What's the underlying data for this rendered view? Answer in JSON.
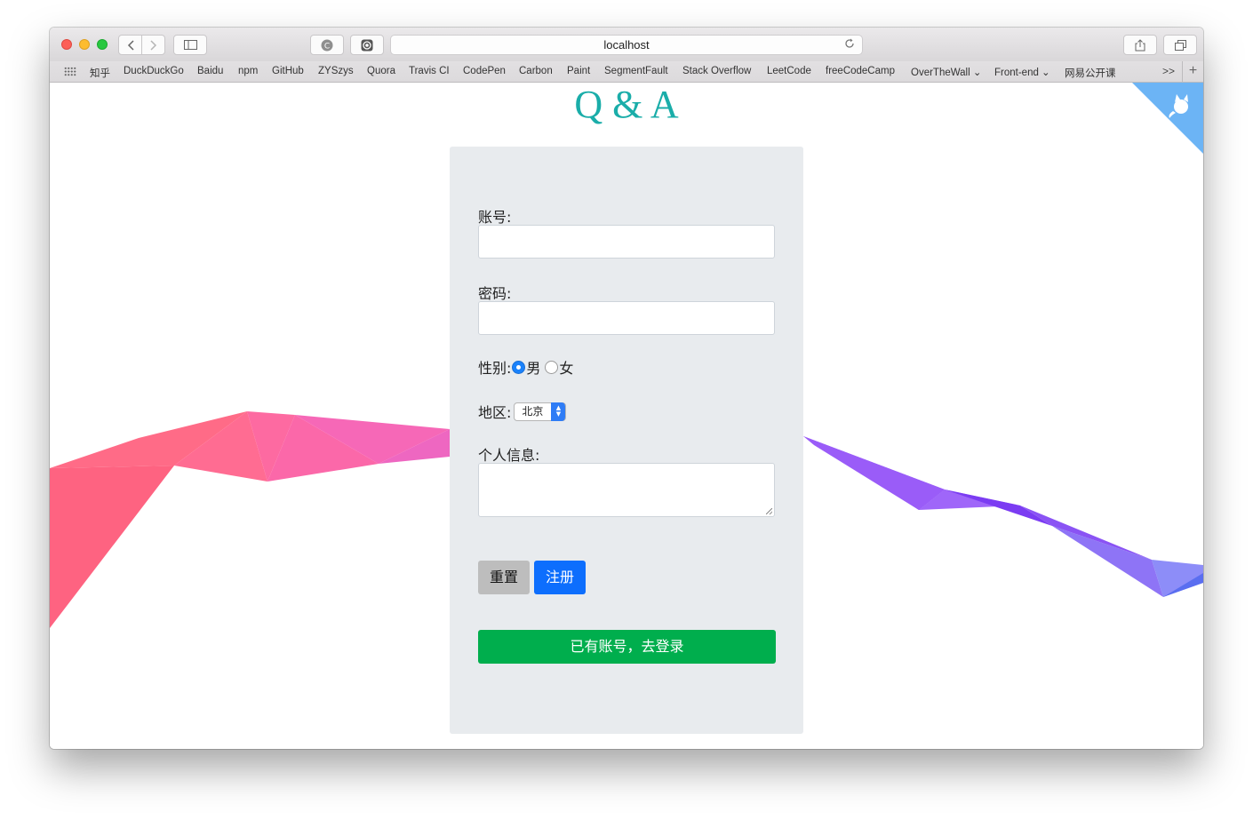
{
  "browser": {
    "address": "localhost",
    "bookmarks": [
      "知乎",
      "DuckDuckGo",
      "Baidu",
      "npm",
      "GitHub",
      "ZYSzys",
      "Quora",
      "Travis CI",
      "CodePen",
      "Carbon",
      "Paint",
      "SegmentFault",
      "Stack Overflow",
      "LeetCode",
      "freeCodeCamp",
      "OverTheWall ⌄",
      "Front-end ⌄",
      "网易公开课"
    ],
    "more_label": ">>",
    "add_label": "+"
  },
  "page": {
    "title": "Q & A",
    "form": {
      "account_label": "账号:",
      "password_label": "密码:",
      "gender_label": "性别:",
      "gender_options": [
        "男",
        "女"
      ],
      "gender_selected": "男",
      "region_label": "地区:",
      "region_value": "北京",
      "info_label": "个人信息:",
      "reset_label": "重置",
      "register_label": "注册",
      "login_label": "已有账号，去登录"
    }
  },
  "colors": {
    "title": "#1aada9",
    "card_bg": "#e8ebee",
    "register": "#0d6efd",
    "login": "#00ae4d",
    "reset": "#bdbdbd",
    "corner": "#6cb4f5"
  }
}
